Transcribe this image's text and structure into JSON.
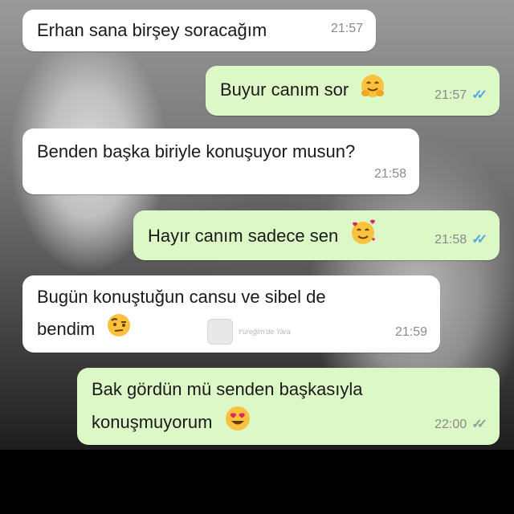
{
  "messages": [
    {
      "text": "Erhan sana birşey soracağım",
      "time": "21:57"
    },
    {
      "text": "Buyur canım sor",
      "time": "21:57",
      "emoji": "hugging-face-icon"
    },
    {
      "text": "Benden başka biriyle konuşuyor musun?",
      "time": "21:58"
    },
    {
      "text": "Hayır canım sadece sen",
      "time": "21:58",
      "emoji": "smiling-face-with-hearts-icon"
    },
    {
      "line1": "Bugün konuştuğun cansu ve sibel de",
      "line2": "bendim",
      "time": "21:59",
      "emoji": "face-with-raised-eyebrow-icon"
    },
    {
      "line1": "Bak gördün mü senden başkasıyla",
      "line2": "konuşmuyorum",
      "time": "22:00",
      "emoji": "heart-eyes-icon"
    }
  ],
  "watermark": {
    "text": "Yüreğim'de Yara"
  },
  "colors": {
    "incoming": "#ffffff",
    "outgoing": "#dcf8c6",
    "read_ticks": "#4fa6e0",
    "sent_ticks": "#9a9a9a"
  }
}
